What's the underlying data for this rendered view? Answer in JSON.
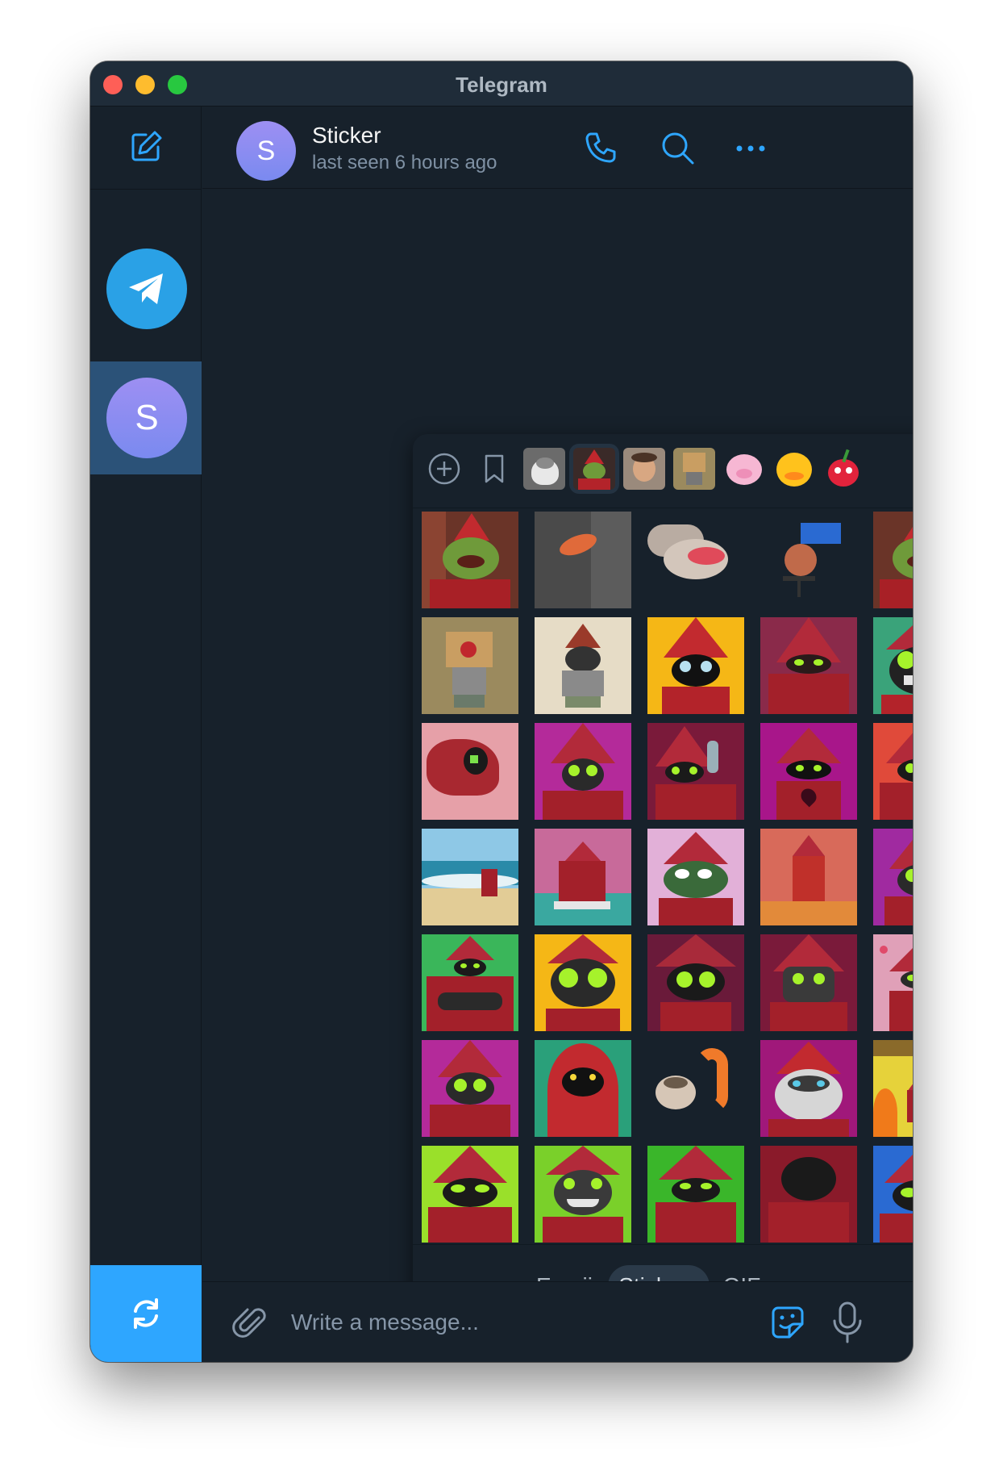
{
  "window": {
    "title": "Telegram"
  },
  "colors": {
    "accent": "#2ea6ff",
    "background": "#17212b",
    "active_chat": "#2b5278"
  },
  "sidebar": {
    "compose_icon": "compose-icon",
    "active_chat_initial": "S",
    "sync_icon": "sync-icon"
  },
  "chat": {
    "avatar_initial": "S",
    "name": "Sticker",
    "status": "last seen 6 hours ago"
  },
  "panel": {
    "tabs": [
      "add-sticker-icon",
      "saved-stickers-icon",
      "cat-pack",
      "kermit-pack",
      "baby-pack",
      "box-head-pack",
      "pink-pig-pack",
      "duck-pack",
      "cherry-pack"
    ],
    "modes": [
      "Emoji",
      "Stickers",
      "GIFs"
    ],
    "active_mode": "Stickers"
  },
  "composer": {
    "placeholder": "Write a message..."
  }
}
